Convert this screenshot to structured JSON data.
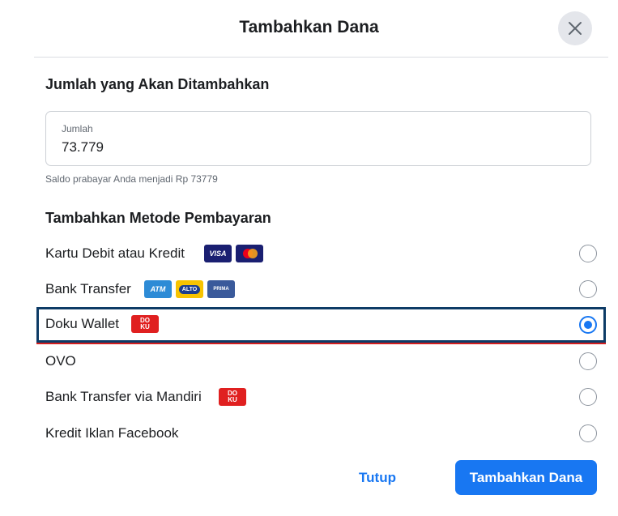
{
  "dialog": {
    "title": "Tambahkan Dana",
    "close_icon": "close-icon"
  },
  "amount_section": {
    "heading": "Jumlah yang Akan Ditambahkan",
    "field_label": "Jumlah",
    "field_value": "73.779",
    "helper_text": "Saldo prabayar Anda menjadi Rp 73779"
  },
  "payment_section": {
    "heading": "Tambahkan Metode Pembayaran",
    "options": [
      {
        "label": "Kartu Debit atau Kredit",
        "logos": [
          "visa",
          "mastercard"
        ],
        "selected": false
      },
      {
        "label": "Bank Transfer",
        "logos": [
          "atm-bersama",
          "alto",
          "prima"
        ],
        "selected": false
      },
      {
        "label": "Doku Wallet",
        "logos": [
          "doku"
        ],
        "selected": true
      },
      {
        "label": "OVO",
        "logos": [],
        "selected": false
      },
      {
        "label": "Bank Transfer via Mandiri",
        "logos": [
          "doku"
        ],
        "selected": false
      },
      {
        "label": "Kredit Iklan Facebook",
        "logos": [],
        "selected": false
      }
    ],
    "logo_text": {
      "visa": "VISA",
      "atm": "ATM",
      "alto": "ALTO",
      "prima": "PRIMA",
      "doku_top": "DO",
      "doku_bottom": "KU"
    }
  },
  "footer": {
    "close_label": "Tutup",
    "submit_label": "Tambahkan Dana"
  },
  "colors": {
    "primary": "#1877f2",
    "selected_border": "#0d3b66",
    "doku_red": "#e02020"
  }
}
